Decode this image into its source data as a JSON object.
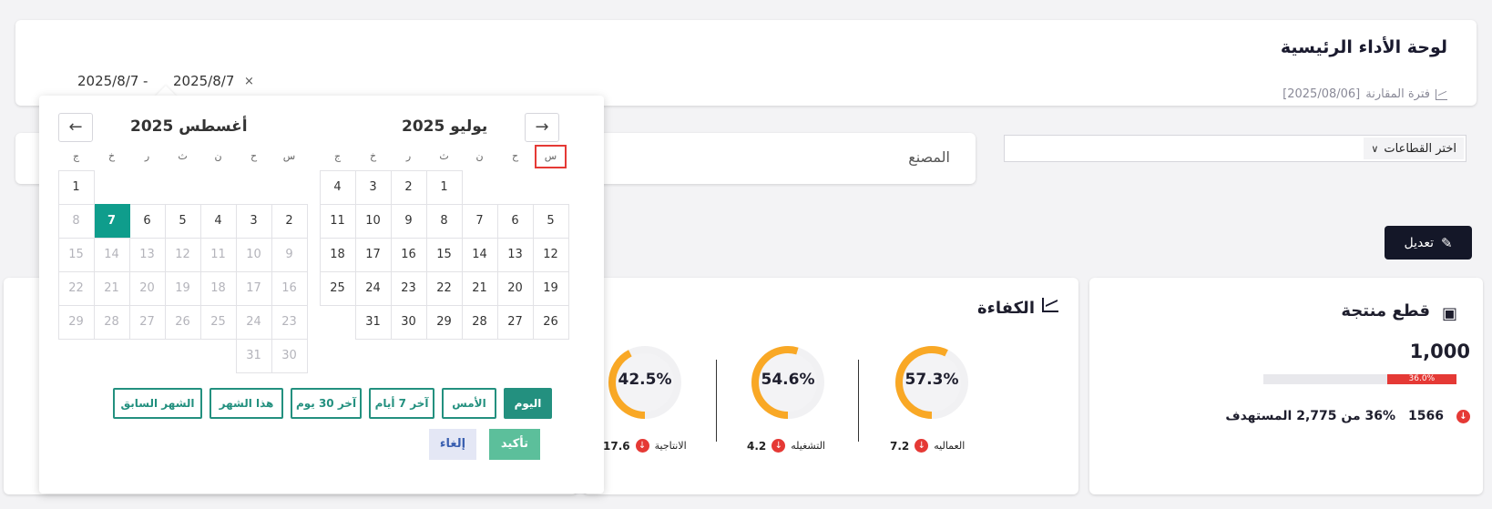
{
  "header": {
    "title": "لوحة الأداء الرئيسية",
    "compare_label": "فترة المقارنة",
    "compare_value": "[2025/08/06]"
  },
  "date_range": {
    "start": "2025/8/7",
    "end": "2025/8/7",
    "separator": "-",
    "clear": "×"
  },
  "filters": {
    "factory_label": "المصنع",
    "sector_placeholder": "اختر القطاعات"
  },
  "edit_button": {
    "label": "تعديل"
  },
  "product_card": {
    "title": "قطع منتجة",
    "value": "1,000",
    "progress_label": "36.0%",
    "progress_fraction": 0.36,
    "actual": "1566",
    "target_text": "36% من 2,775 المستهدف"
  },
  "efficiency_card": {
    "title": "الكفاءة",
    "gauges": [
      {
        "label": "العماليه",
        "value_text": "57.3%",
        "value": 57.3,
        "delta": "7.2"
      },
      {
        "label": "التشغيله",
        "value_text": "54.6%",
        "value": 54.6,
        "delta": "4.2"
      },
      {
        "label": "الانتاجية",
        "value_text": "42.5%",
        "value": 42.5,
        "delta": "17.6"
      }
    ],
    "color": "#f9a825"
  },
  "picker": {
    "weekdays": [
      "س",
      "ح",
      "ن",
      "ث",
      "ر",
      "خ",
      "ج"
    ],
    "july": {
      "title": "يوليو 2025",
      "rows": [
        [
          "",
          "",
          "",
          "1",
          "2",
          "3",
          "4"
        ],
        [
          "5",
          "6",
          "7",
          "8",
          "9",
          "10",
          "11"
        ],
        [
          "12",
          "13",
          "14",
          "15",
          "16",
          "17",
          "18"
        ],
        [
          "19",
          "20",
          "21",
          "22",
          "23",
          "24",
          "25"
        ],
        [
          "26",
          "27",
          "28",
          "29",
          "30",
          "31",
          ""
        ]
      ]
    },
    "august": {
      "title": "أغسطس 2025",
      "rows": [
        [
          "",
          "",
          "",
          "",
          "",
          "",
          "1"
        ],
        [
          "2",
          "3",
          "4",
          "5",
          "6",
          "7",
          "8"
        ],
        [
          "9",
          "10",
          "11",
          "12",
          "13",
          "14",
          "15"
        ],
        [
          "16",
          "17",
          "18",
          "19",
          "20",
          "21",
          "22"
        ],
        [
          "23",
          "24",
          "25",
          "26",
          "27",
          "28",
          "29"
        ],
        [
          "30",
          "31",
          "",
          "",
          "",
          "",
          ""
        ]
      ]
    },
    "presets": [
      "اليوم",
      "الأمس",
      "آخر 7 أيام",
      "آخر 30 يوم",
      "هذا الشهر",
      "الشهر السابق"
    ],
    "confirm": "تأكيد",
    "cancel": "إلغاء",
    "prev_icon": "arrow-left-icon",
    "next_icon": "arrow-right-icon"
  },
  "colors": {
    "primary": "#23907f",
    "today": "#0f9d8c",
    "danger": "#e53935",
    "dark_button": "#141728"
  }
}
